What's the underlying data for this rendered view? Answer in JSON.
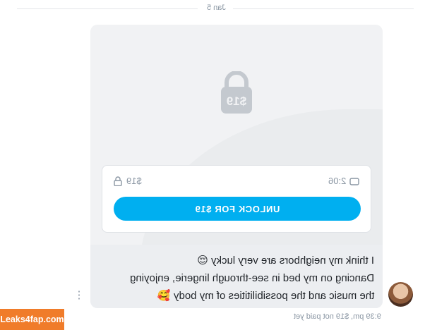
{
  "date_separator": "Jan 5",
  "media": {
    "lock_price": "$19",
    "duration": "2:06",
    "price_label": "$19",
    "unlock_label": "UNLOCK FOR $19"
  },
  "message": {
    "line1": "I think my neighbors are very lucky",
    "line1_emoji": "😌",
    "line2": "Dancing on my bed in see-through lingerie, enjoying",
    "line3": "the music and the possibilitities of my body",
    "line3_emoji": "🥰"
  },
  "footer": {
    "time": "9:39 pm,",
    "status": "$19 not paid yet"
  },
  "watermark": "Leaks4fap.com",
  "colors": {
    "accent": "#00aff0",
    "muted": "#8a96a3",
    "watermark": "#f07c2a"
  },
  "icons": [
    "lock-icon",
    "video-icon",
    "more-vertical-icon"
  ]
}
